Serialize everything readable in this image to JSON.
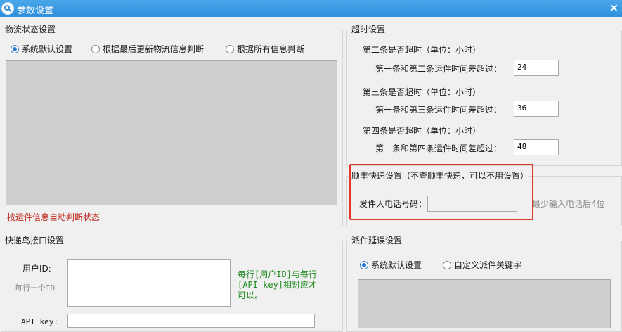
{
  "window": {
    "title": "参数设置",
    "icon": "search-app-icon",
    "close_glyph": "✕"
  },
  "logistics_status": {
    "title": "物流状态设置",
    "options": [
      {
        "label": "系统默认设置",
        "checked": true
      },
      {
        "label": "根据最后更新物流信息判断",
        "checked": false
      },
      {
        "label": "根据所有信息判断",
        "checked": false
      }
    ],
    "footer_note": "按运件信息自动判断状态"
  },
  "timeout": {
    "title": "超时设置",
    "rows": [
      {
        "heading": "第二条是否超时（单位：小时）",
        "label": "第一条和第二条运件时间差超过：",
        "value": "24"
      },
      {
        "heading": "第三条是否超时（单位：小时）",
        "label": "第一条和第三条运件时间差超过：",
        "value": "36"
      },
      {
        "heading": "第四条是否超时（单位：小时）",
        "label": "第一条和第四条运件时间差超过：",
        "value": "48"
      }
    ]
  },
  "sf_express": {
    "title": "顺丰快递设置（不查顺丰快递，可以不用设置）",
    "phone_label": "发件人电话号码：",
    "phone_value": "",
    "phone_hint": "最少输入电话后4位"
  },
  "kdniao": {
    "title": "快递鸟接口设置",
    "user_id_label": "用户ID:",
    "user_id_sub": "每行一个ID",
    "user_id_value": "",
    "note": "每行[用户ID]与每行[API key]相对应才可以。",
    "note_lines": [
      "每行[用户ID]与每行",
      "[API key]相对应才",
      "可以。"
    ],
    "api_key_label": "API key:",
    "api_key_value": ""
  },
  "delivery_delay": {
    "title": "派件延误设置",
    "options": [
      {
        "label": "系统默认设置",
        "checked": true
      },
      {
        "label": "自定义派件关键字",
        "checked": false
      }
    ]
  },
  "colors": {
    "titlebar": "#3a9ae3",
    "highlight": "#e0362c",
    "note_red": "#c0241c",
    "note_green": "#1f8a1f"
  }
}
